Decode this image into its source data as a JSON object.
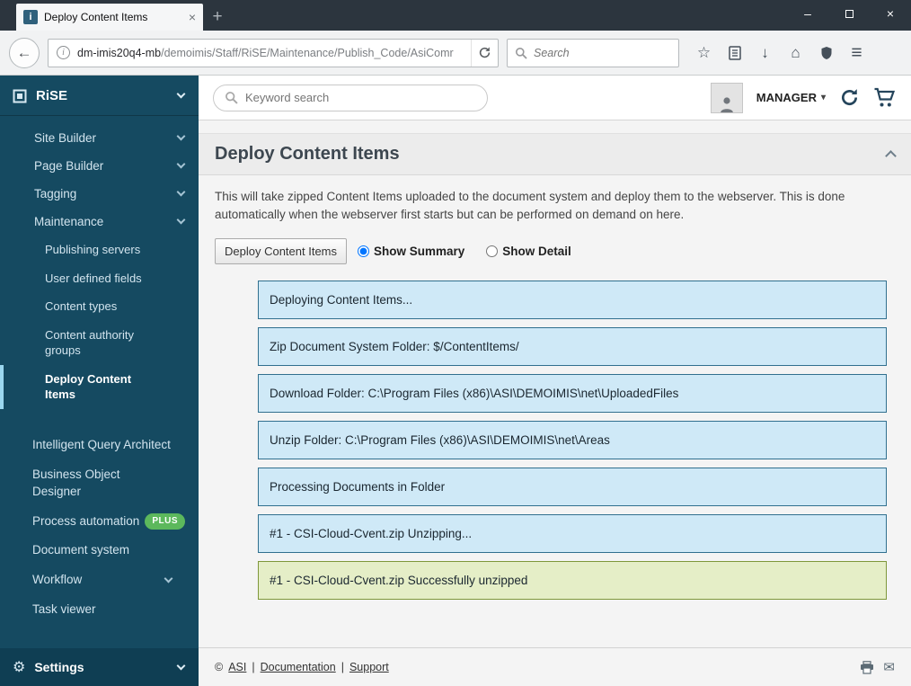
{
  "browser": {
    "tab_title": "Deploy Content Items",
    "url_domain": "dm-imis20q4-mb",
    "url_path": "/demoimis/Staff/RiSE/Maintenance/Publish_Code/AsiComr",
    "search_placeholder": "Search"
  },
  "icons": {
    "favicon_letter": "i",
    "back": "←",
    "info": "i",
    "plus": "+",
    "minimize": "–",
    "close": "×",
    "tab_close": "×",
    "star": "☆",
    "download": "↓",
    "home": "⌂",
    "menu": "≡",
    "caret_down": "▾",
    "envelope": "✉",
    "gear": "⚙"
  },
  "sidebar": {
    "root_label": "RiSE",
    "top_items": [
      {
        "label": "Site Builder"
      },
      {
        "label": "Page Builder"
      },
      {
        "label": "Tagging"
      },
      {
        "label": "Maintenance"
      }
    ],
    "maintenance_children": [
      {
        "label": "Publishing servers"
      },
      {
        "label": "User defined fields"
      },
      {
        "label": "Content types"
      },
      {
        "label": "Content authority groups"
      },
      {
        "label": "Deploy Content Items"
      }
    ],
    "secondary_items": [
      {
        "label": "Intelligent Query Architect"
      },
      {
        "label": "Business Object Designer"
      },
      {
        "label": "Process automation",
        "badge": "PLUS"
      },
      {
        "label": "Document system"
      },
      {
        "label": "Workflow"
      },
      {
        "label": "Task viewer"
      }
    ],
    "settings_label": "Settings"
  },
  "topbar": {
    "keyword_placeholder": "Keyword search",
    "user_label": "MANAGER"
  },
  "page": {
    "title": "Deploy Content Items",
    "description": "This will take zipped Content Items uploaded to the document system and deploy them to the webserver. This is done automatically when the webserver first starts but can be performed on demand on here.",
    "deploy_button_label": "Deploy Content Items",
    "radio_summary_label": "Show Summary",
    "radio_detail_label": "Show Detail",
    "messages": [
      {
        "text": "Deploying Content Items...",
        "type": "info"
      },
      {
        "text": "Zip Document System Folder: $/ContentItems/",
        "type": "info"
      },
      {
        "text": "Download Folder: C:\\Program Files (x86)\\ASI\\DEMOIMIS\\net\\UploadedFiles",
        "type": "info"
      },
      {
        "text": "Unzip Folder: C:\\Program Files (x86)\\ASI\\DEMOIMIS\\net\\Areas",
        "type": "info"
      },
      {
        "text": "Processing Documents in Folder",
        "type": "info"
      },
      {
        "text": "#1 - CSI-Cloud-Cvent.zip Unzipping...",
        "type": "info"
      },
      {
        "text": "#1 - CSI-Cloud-Cvent.zip Successfully unzipped",
        "type": "success"
      }
    ]
  },
  "footer": {
    "copyright_symbol": "©",
    "links": [
      "ASI",
      "Documentation",
      "Support"
    ],
    "separator": "|"
  },
  "colors": {
    "sidebar_bg": "#154a61",
    "info_box_bg": "#cfe9f7",
    "info_box_border": "#31708f",
    "success_box_bg": "#e5eec7",
    "success_box_border": "#7f973b",
    "badge_green": "#5cb85c"
  }
}
